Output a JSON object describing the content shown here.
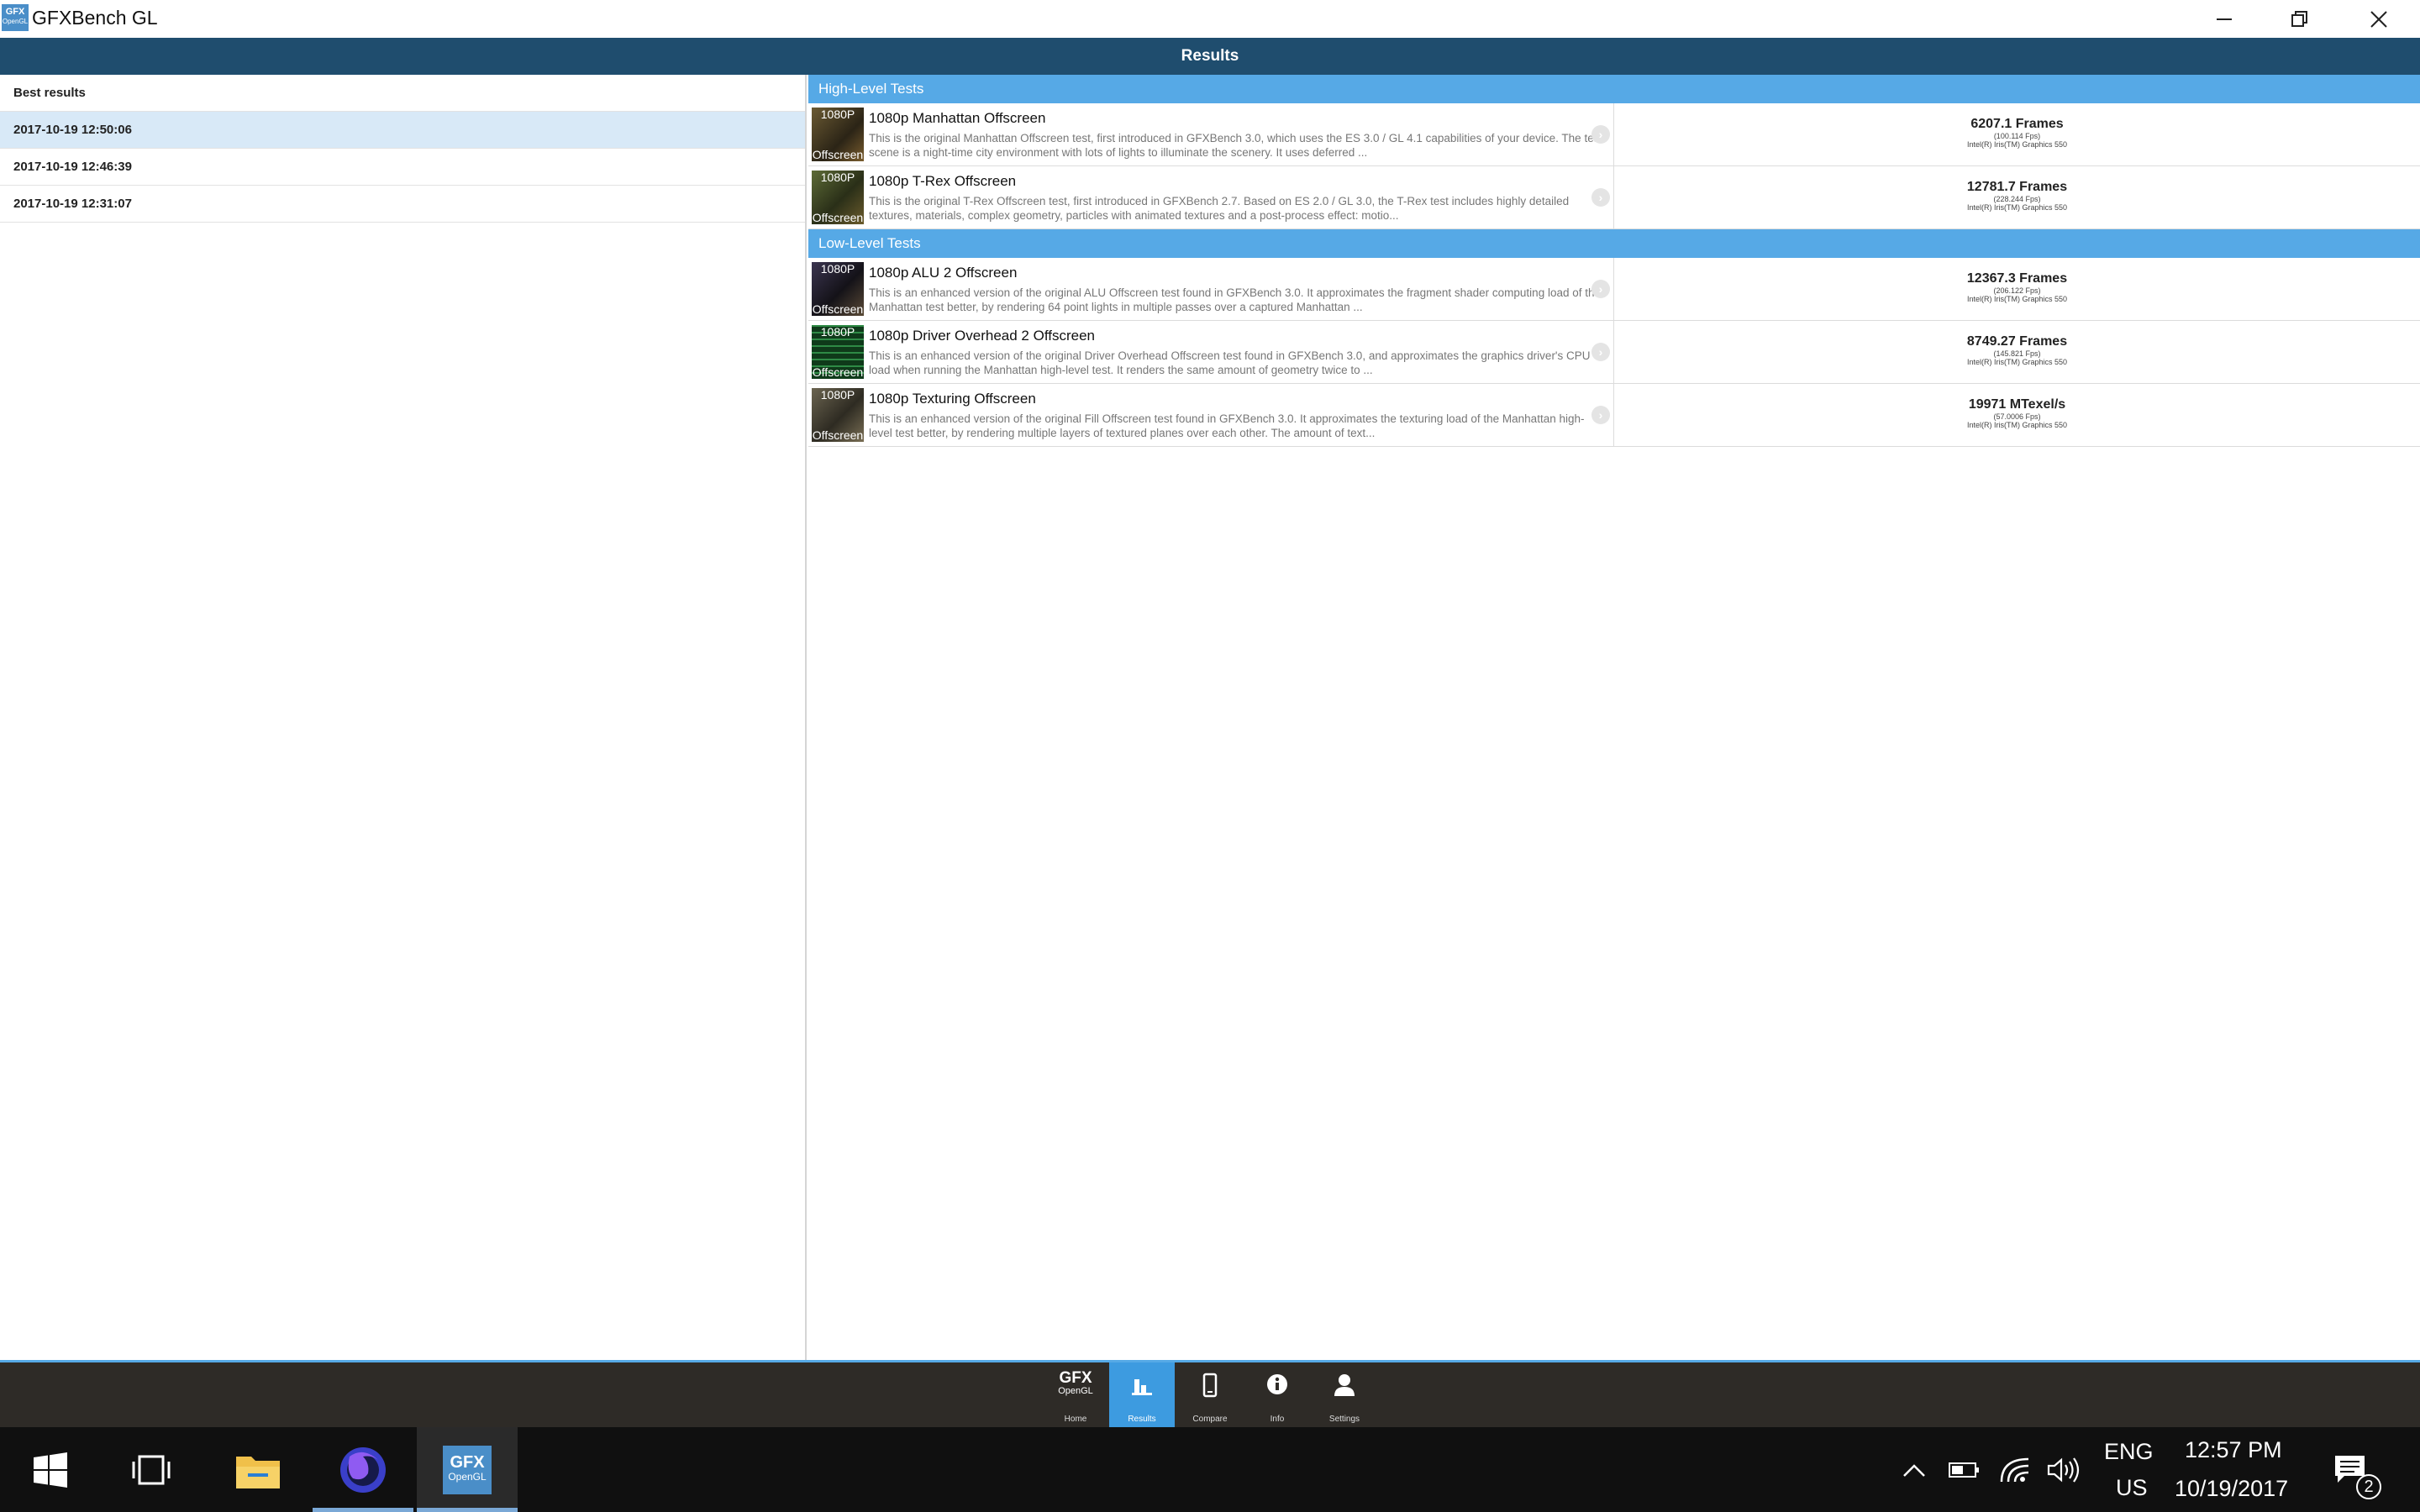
{
  "window": {
    "title": "GFXBench GL",
    "logo_top": "GFX",
    "logo_bottom": "OpenGL"
  },
  "header": {
    "title": "Results"
  },
  "left": {
    "title": "Best results",
    "runs": [
      "2017-10-19 12:50:06",
      "2017-10-19 12:46:39",
      "2017-10-19 12:31:07"
    ]
  },
  "sections": {
    "high": "High-Level Tests",
    "low": "Low-Level Tests"
  },
  "tests": [
    {
      "name": "1080p Manhattan Offscreen",
      "thumb_top": "1080P",
      "thumb_bottom": "Offscreen",
      "desc": "This is the original Manhattan Offscreen test, first introduced in GFXBench 3.0, which uses the ES 3.0 / GL 4.1 capabilities of your device. The test scene is a night-time city environment with lots of lights to illuminate the scenery. It uses deferred ...",
      "score": "6207.1 Frames",
      "fps": "(100.114 Fps)",
      "gpu": "Intel(R) Iris(TM) Graphics 550",
      "thumb_color": "#4a3c22"
    },
    {
      "name": "1080p T-Rex Offscreen",
      "thumb_top": "1080P",
      "thumb_bottom": "Offscreen",
      "desc": "This is the original T-Rex Offscreen test, first introduced in GFXBench 2.7. Based on ES 2.0 / GL 3.0, the T-Rex test includes highly detailed textures, materials, complex geometry, particles with animated textures and a post-process effect: motio...",
      "score": "12781.7 Frames",
      "fps": "(228.244 Fps)",
      "gpu": "Intel(R) Iris(TM) Graphics 550",
      "thumb_color": "#3f4d2a"
    },
    {
      "name": "1080p ALU 2 Offscreen",
      "thumb_top": "1080P",
      "thumb_bottom": "Offscreen",
      "desc": "This is an enhanced version of the original ALU Offscreen test found in GFXBench 3.0. It approximates the fragment shader computing load of the Manhattan test better, by rendering 64 point lights in multiple passes over a captured Manhattan ...",
      "score": "12367.3 Frames",
      "fps": "(206.122 Fps)",
      "gpu": "Intel(R) Iris(TM) Graphics 550",
      "thumb_color": "#2d2a33"
    },
    {
      "name": "1080p Driver Overhead 2 Offscreen",
      "thumb_top": "1080P",
      "thumb_bottom": "Offscreen",
      "desc": "This is an enhanced version of the original Driver Overhead Offscreen test found in GFXBench 3.0, and approximates the graphics driver's CPU load when running the Manhattan high-level test. It renders the same amount of geometry twice to ...",
      "score": "8749.27 Frames",
      "fps": "(145.821 Fps)",
      "gpu": "Intel(R) Iris(TM) Graphics 550",
      "thumb_color": "#1f5a2c"
    },
    {
      "name": "1080p Texturing Offscreen",
      "thumb_top": "1080P",
      "thumb_bottom": "Offscreen",
      "desc": "This is an enhanced version of the original Fill Offscreen test found in GFXBench 3.0. It approximates the texturing load of the Manhattan high-level test better, by rendering multiple layers of textured planes over each other. The amount of text...",
      "score": "19971 MTexel/s",
      "fps": "(57.0006 Fps)",
      "gpu": "Intel(R) Iris(TM) Graphics 550",
      "thumb_color": "#4e4a3c"
    }
  ],
  "bottom_nav": {
    "logo_top": "GFX",
    "logo_bottom": "OpenGL",
    "home": "Home",
    "results": "Results",
    "compare": "Compare",
    "info": "Info",
    "settings": "Settings"
  },
  "taskbar": {
    "lang_top": "ENG",
    "lang_bottom": "US",
    "time": "12:57 PM",
    "date": "10/19/2017",
    "notifications": "2",
    "app_logo_top": "GFX",
    "app_logo_bottom": "OpenGL"
  }
}
